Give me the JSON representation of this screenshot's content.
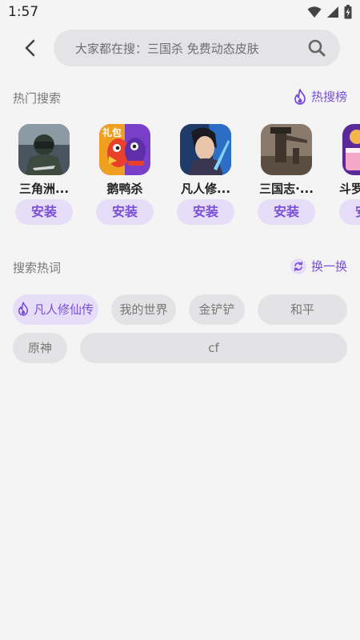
{
  "status_bar": {
    "time": "1:57"
  },
  "search": {
    "placeholder": "大家都在搜：三国杀  免费动态皮肤"
  },
  "hot_search": {
    "title": "热门搜索",
    "action_label": "热搜榜",
    "games": [
      {
        "name": "三角洲...",
        "install_label": "安装",
        "badge": ""
      },
      {
        "name": "鹅鸭杀",
        "install_label": "安装",
        "badge": "礼包"
      },
      {
        "name": "凡人修...",
        "install_label": "安装",
        "badge": ""
      },
      {
        "name": "三国志·...",
        "install_label": "安装",
        "badge": ""
      },
      {
        "name": "斗罗",
        "install_label": "安装",
        "badge": ""
      }
    ]
  },
  "hot_words": {
    "title": "搜索热词",
    "refresh_label": "换一换",
    "chips": [
      "凡人修仙传",
      "我的世界",
      "金铲铲",
      "和平",
      "原神",
      "cf"
    ]
  },
  "colors": {
    "accent": "#7a4fd6",
    "accent_bg": "#e6def8",
    "chip_bg": "#e3e3e5",
    "page_bg": "#f4f4f5"
  }
}
